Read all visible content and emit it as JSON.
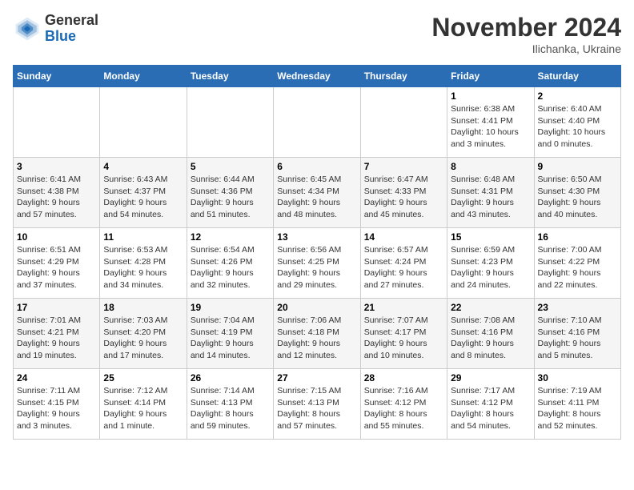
{
  "header": {
    "logo_general": "General",
    "logo_blue": "Blue",
    "month_title": "November 2024",
    "location": "Ilichanka, Ukraine"
  },
  "days_of_week": [
    "Sunday",
    "Monday",
    "Tuesday",
    "Wednesday",
    "Thursday",
    "Friday",
    "Saturday"
  ],
  "weeks": [
    [
      {
        "day": "",
        "info": ""
      },
      {
        "day": "",
        "info": ""
      },
      {
        "day": "",
        "info": ""
      },
      {
        "day": "",
        "info": ""
      },
      {
        "day": "",
        "info": ""
      },
      {
        "day": "1",
        "info": "Sunrise: 6:38 AM\nSunset: 4:41 PM\nDaylight: 10 hours\nand 3 minutes."
      },
      {
        "day": "2",
        "info": "Sunrise: 6:40 AM\nSunset: 4:40 PM\nDaylight: 10 hours\nand 0 minutes."
      }
    ],
    [
      {
        "day": "3",
        "info": "Sunrise: 6:41 AM\nSunset: 4:38 PM\nDaylight: 9 hours\nand 57 minutes."
      },
      {
        "day": "4",
        "info": "Sunrise: 6:43 AM\nSunset: 4:37 PM\nDaylight: 9 hours\nand 54 minutes."
      },
      {
        "day": "5",
        "info": "Sunrise: 6:44 AM\nSunset: 4:36 PM\nDaylight: 9 hours\nand 51 minutes."
      },
      {
        "day": "6",
        "info": "Sunrise: 6:45 AM\nSunset: 4:34 PM\nDaylight: 9 hours\nand 48 minutes."
      },
      {
        "day": "7",
        "info": "Sunrise: 6:47 AM\nSunset: 4:33 PM\nDaylight: 9 hours\nand 45 minutes."
      },
      {
        "day": "8",
        "info": "Sunrise: 6:48 AM\nSunset: 4:31 PM\nDaylight: 9 hours\nand 43 minutes."
      },
      {
        "day": "9",
        "info": "Sunrise: 6:50 AM\nSunset: 4:30 PM\nDaylight: 9 hours\nand 40 minutes."
      }
    ],
    [
      {
        "day": "10",
        "info": "Sunrise: 6:51 AM\nSunset: 4:29 PM\nDaylight: 9 hours\nand 37 minutes."
      },
      {
        "day": "11",
        "info": "Sunrise: 6:53 AM\nSunset: 4:28 PM\nDaylight: 9 hours\nand 34 minutes."
      },
      {
        "day": "12",
        "info": "Sunrise: 6:54 AM\nSunset: 4:26 PM\nDaylight: 9 hours\nand 32 minutes."
      },
      {
        "day": "13",
        "info": "Sunrise: 6:56 AM\nSunset: 4:25 PM\nDaylight: 9 hours\nand 29 minutes."
      },
      {
        "day": "14",
        "info": "Sunrise: 6:57 AM\nSunset: 4:24 PM\nDaylight: 9 hours\nand 27 minutes."
      },
      {
        "day": "15",
        "info": "Sunrise: 6:59 AM\nSunset: 4:23 PM\nDaylight: 9 hours\nand 24 minutes."
      },
      {
        "day": "16",
        "info": "Sunrise: 7:00 AM\nSunset: 4:22 PM\nDaylight: 9 hours\nand 22 minutes."
      }
    ],
    [
      {
        "day": "17",
        "info": "Sunrise: 7:01 AM\nSunset: 4:21 PM\nDaylight: 9 hours\nand 19 minutes."
      },
      {
        "day": "18",
        "info": "Sunrise: 7:03 AM\nSunset: 4:20 PM\nDaylight: 9 hours\nand 17 minutes."
      },
      {
        "day": "19",
        "info": "Sunrise: 7:04 AM\nSunset: 4:19 PM\nDaylight: 9 hours\nand 14 minutes."
      },
      {
        "day": "20",
        "info": "Sunrise: 7:06 AM\nSunset: 4:18 PM\nDaylight: 9 hours\nand 12 minutes."
      },
      {
        "day": "21",
        "info": "Sunrise: 7:07 AM\nSunset: 4:17 PM\nDaylight: 9 hours\nand 10 minutes."
      },
      {
        "day": "22",
        "info": "Sunrise: 7:08 AM\nSunset: 4:16 PM\nDaylight: 9 hours\nand 8 minutes."
      },
      {
        "day": "23",
        "info": "Sunrise: 7:10 AM\nSunset: 4:16 PM\nDaylight: 9 hours\nand 5 minutes."
      }
    ],
    [
      {
        "day": "24",
        "info": "Sunrise: 7:11 AM\nSunset: 4:15 PM\nDaylight: 9 hours\nand 3 minutes."
      },
      {
        "day": "25",
        "info": "Sunrise: 7:12 AM\nSunset: 4:14 PM\nDaylight: 9 hours\nand 1 minute."
      },
      {
        "day": "26",
        "info": "Sunrise: 7:14 AM\nSunset: 4:13 PM\nDaylight: 8 hours\nand 59 minutes."
      },
      {
        "day": "27",
        "info": "Sunrise: 7:15 AM\nSunset: 4:13 PM\nDaylight: 8 hours\nand 57 minutes."
      },
      {
        "day": "28",
        "info": "Sunrise: 7:16 AM\nSunset: 4:12 PM\nDaylight: 8 hours\nand 55 minutes."
      },
      {
        "day": "29",
        "info": "Sunrise: 7:17 AM\nSunset: 4:12 PM\nDaylight: 8 hours\nand 54 minutes."
      },
      {
        "day": "30",
        "info": "Sunrise: 7:19 AM\nSunset: 4:11 PM\nDaylight: 8 hours\nand 52 minutes."
      }
    ]
  ]
}
